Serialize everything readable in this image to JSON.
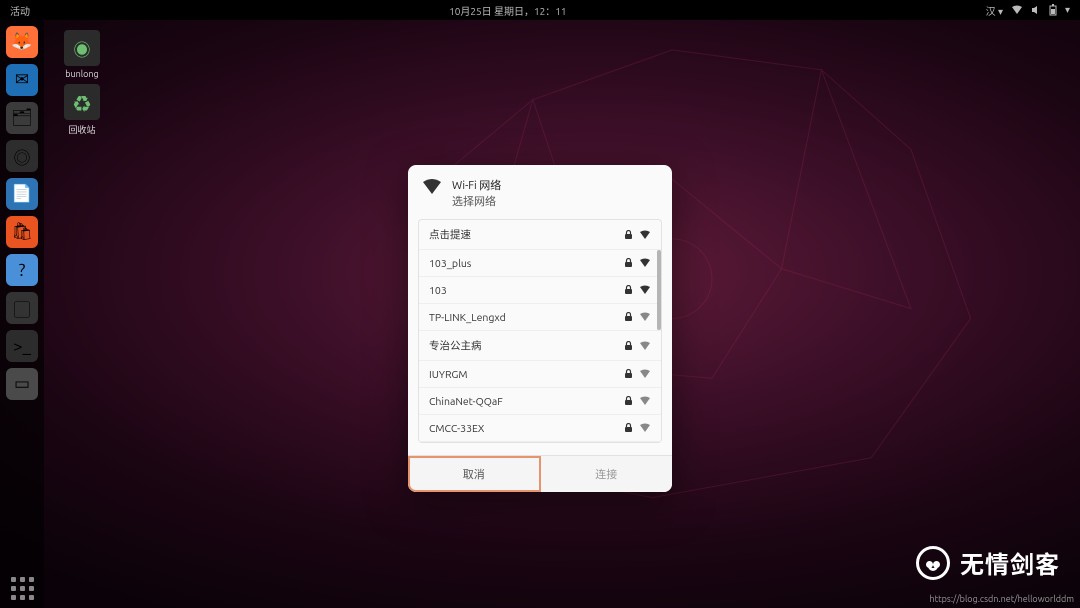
{
  "topbar": {
    "activities": "活动",
    "clock": "10月25日 星期日，12：11",
    "lang_indicator": "汉 ▾"
  },
  "desktop_icons": [
    {
      "label": "bunlong",
      "glyph": "◉"
    },
    {
      "label": "回收站",
      "glyph": "♻"
    }
  ],
  "dock": [
    {
      "name": "firefox",
      "bg": "#ff7139",
      "glyph": "🦊"
    },
    {
      "name": "thunderbird",
      "bg": "#1f6fb6",
      "glyph": "✉"
    },
    {
      "name": "files",
      "bg": "#3b3b3b",
      "glyph": "🗂"
    },
    {
      "name": "rhythmbox",
      "bg": "#2d2d2d",
      "glyph": "◎"
    },
    {
      "name": "writer",
      "bg": "#2e74b5",
      "glyph": "📄"
    },
    {
      "name": "software",
      "bg": "#e95420",
      "glyph": "🛍"
    },
    {
      "name": "help",
      "bg": "#4a90d9",
      "glyph": "?"
    },
    {
      "name": "screenshot",
      "bg": "#333333",
      "glyph": "▢"
    },
    {
      "name": "terminal",
      "bg": "#2c2c2c",
      "glyph": ">_"
    },
    {
      "name": "window",
      "bg": "#4a4a4a",
      "glyph": "▭"
    }
  ],
  "dialog": {
    "title": "Wi-Fi 网络",
    "subtitle": "选择网络",
    "networks": [
      {
        "ssid": "点击提速",
        "locked": true,
        "signal": "strong"
      },
      {
        "ssid": "103_plus",
        "locked": true,
        "signal": "strong"
      },
      {
        "ssid": "103",
        "locked": true,
        "signal": "strong"
      },
      {
        "ssid": "TP-LINK_Lengxd",
        "locked": true,
        "signal": "medium"
      },
      {
        "ssid": "专治公主病",
        "locked": true,
        "signal": "medium"
      },
      {
        "ssid": "IUYRGM",
        "locked": true,
        "signal": "medium"
      },
      {
        "ssid": "ChinaNet-QQaF",
        "locked": true,
        "signal": "medium"
      },
      {
        "ssid": "CMCC-33EX",
        "locked": true,
        "signal": "weak"
      }
    ],
    "cancel_label": "取消",
    "connect_label": "连接"
  },
  "watermark": {
    "text": "无情剑客"
  },
  "footer_url": "https://blog.csdn.net/helloworlddm"
}
